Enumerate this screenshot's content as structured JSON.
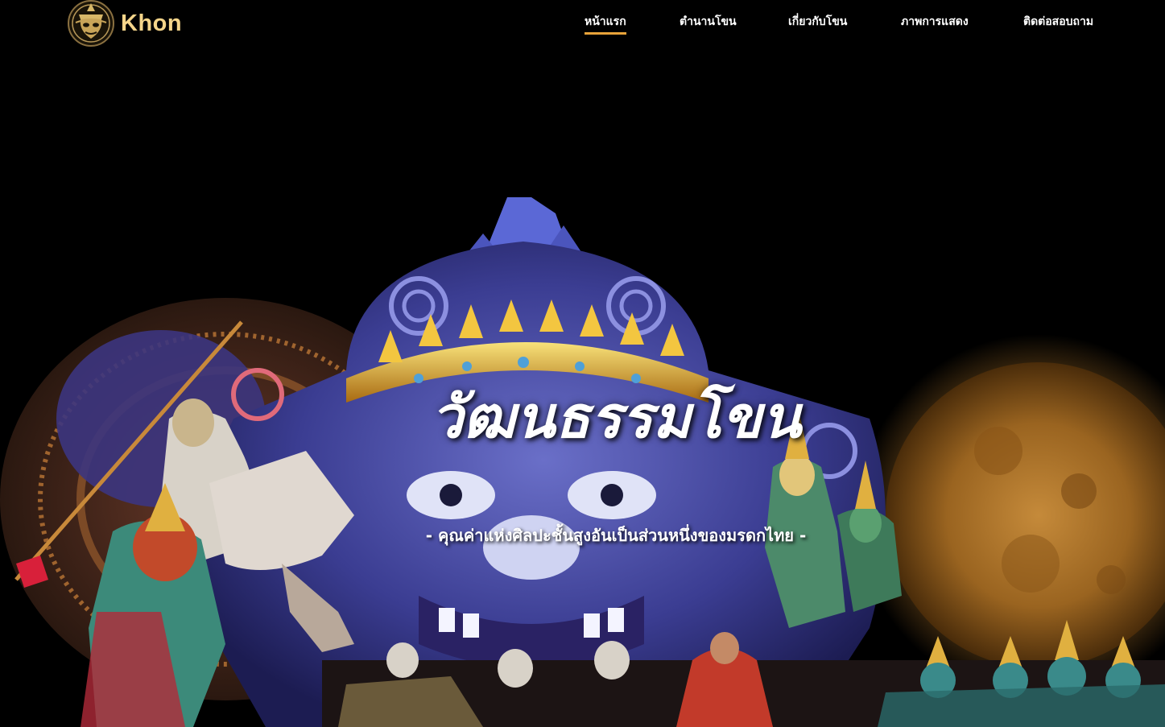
{
  "brand": {
    "name": "Khon",
    "logo_icon": "khon-mask-icon",
    "accent_color": "#f5d58a"
  },
  "nav": {
    "items": [
      {
        "label": "หน้าแรก",
        "active": true
      },
      {
        "label": "ตำนานโขน",
        "active": false
      },
      {
        "label": "เกี่ยวกับโขน",
        "active": false
      },
      {
        "label": "ภาพการแสดง",
        "active": false
      },
      {
        "label": "ติดต่อสอบถาม",
        "active": false
      }
    ],
    "active_underline_color": "#e8a33a"
  },
  "hero": {
    "title": "วัฒนธรรมโขน",
    "subtitle": "- คุณค่าแห่งศิลปะชั้นสูงอันเป็นส่วนหนึ่งของมรดกไทย -",
    "image": "khon-performance-hero-image"
  }
}
